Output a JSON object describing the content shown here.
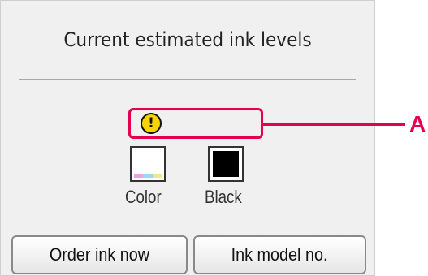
{
  "screen": {
    "title": "Current estimated ink levels"
  },
  "ink": {
    "warning_icon": "exclamation-warning-icon",
    "cartridges": [
      {
        "label": "Color",
        "icon": "color-ink-cartridge-icon"
      },
      {
        "label": "Black",
        "icon": "black-ink-cartridge-icon"
      }
    ]
  },
  "callout": {
    "letter": "A",
    "color": "#e4004f"
  },
  "buttons": {
    "order_label": "Order ink now",
    "model_label": "Ink model no."
  }
}
